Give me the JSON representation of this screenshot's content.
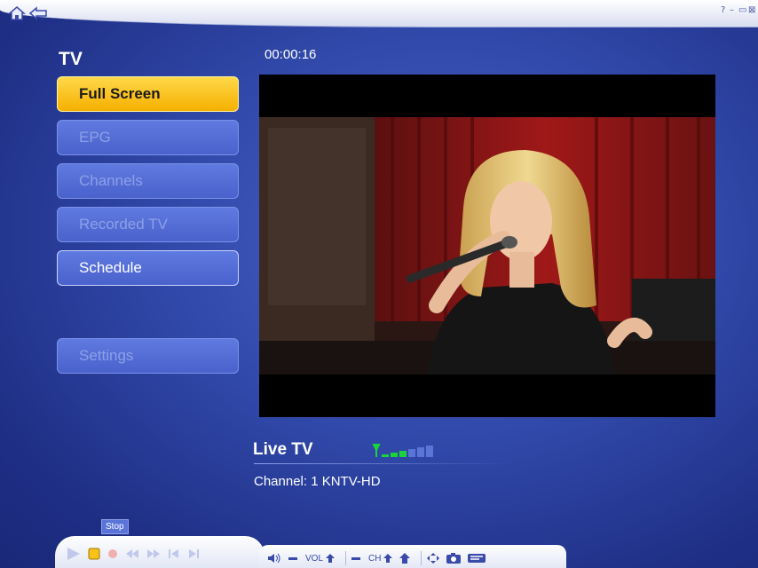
{
  "topbar": {
    "home_icon": "home-icon",
    "back_icon": "back-arrow-icon",
    "help": "?",
    "minimize": "–",
    "restore": "▭",
    "close": "⊠"
  },
  "sidebar": {
    "title": "TV",
    "items": [
      {
        "label": "Full Screen",
        "state": "selected"
      },
      {
        "label": "EPG",
        "state": "disabled"
      },
      {
        "label": "Channels",
        "state": "disabled"
      },
      {
        "label": "Recorded TV",
        "state": "disabled"
      },
      {
        "label": "Schedule",
        "state": "enabled"
      },
      {
        "label": "Settings",
        "state": "disabled"
      }
    ]
  },
  "player": {
    "timecode": "00:00:16",
    "status": "Live TV",
    "channel": "Channel: 1 KNTV-HD",
    "signal_bars_lit": 3,
    "signal_bars_total": 6
  },
  "controls": {
    "tooltip": "Stop",
    "vol_label": "VOL",
    "ch_label": "CH",
    "buttons": [
      "play-icon",
      "stop-icon",
      "record-icon",
      "rewind-icon",
      "fast-forward-icon",
      "skip-back-icon",
      "skip-forward-icon"
    ],
    "extra": [
      "mute-icon",
      "vol-down-icon",
      "vol-up-icon",
      "ch-down-icon",
      "ch-up-icon",
      "recent-icon",
      "fullscreen-icon",
      "snapshot-icon",
      "teletext-icon"
    ]
  },
  "colors": {
    "accent": "#f5b000",
    "background": "#3048a8",
    "signal": "#19d43a"
  }
}
